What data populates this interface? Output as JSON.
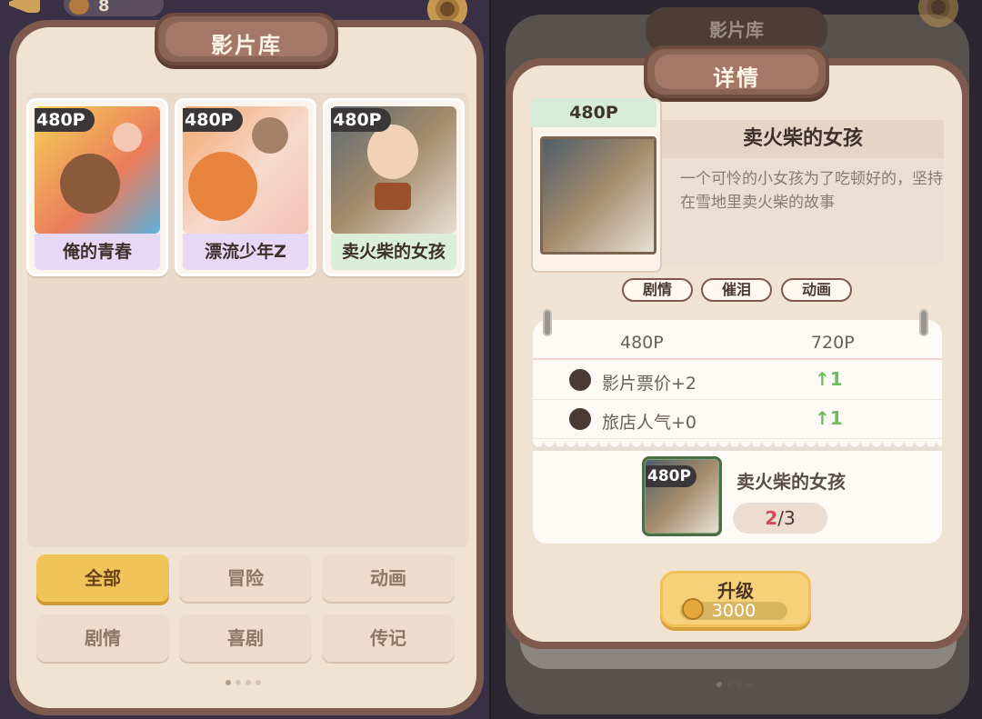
{
  "hud": {
    "count": "8"
  },
  "library": {
    "title": "影片库",
    "films": [
      {
        "price": "480P",
        "name": "俺的青春"
      },
      {
        "price": "480P",
        "name": "漂流少年Z"
      },
      {
        "price": "480P",
        "name": "卖火柴的女孩"
      }
    ],
    "filters": [
      "全部",
      "冒险",
      "动画",
      "剧情",
      "喜剧",
      "传记"
    ],
    "active_filter": "全部"
  },
  "detail": {
    "back_title": "影片库",
    "title": "详情",
    "price": "480P",
    "film_name": "卖火柴的女孩",
    "description": "一个可怜的小女孩为了吃顿好的，坚持在雪地里卖火柴的故事",
    "tags": [
      "剧情",
      "催泪",
      "动画"
    ],
    "stats": {
      "header_current": "480P",
      "header_next": "720P",
      "rows": [
        {
          "label": "影片票价+2",
          "delta": "↑1"
        },
        {
          "label": "旅店人气+0",
          "delta": "↑1"
        }
      ]
    },
    "requirement": {
      "price": "480P",
      "name": "卖火柴的女孩",
      "current": "2",
      "total": "/3"
    },
    "upgrade": {
      "label": "升级",
      "cost": "3000"
    }
  },
  "colors": {
    "accent": "#f1c45a",
    "frame": "#7d5a4d",
    "up": "#6abd5a"
  }
}
